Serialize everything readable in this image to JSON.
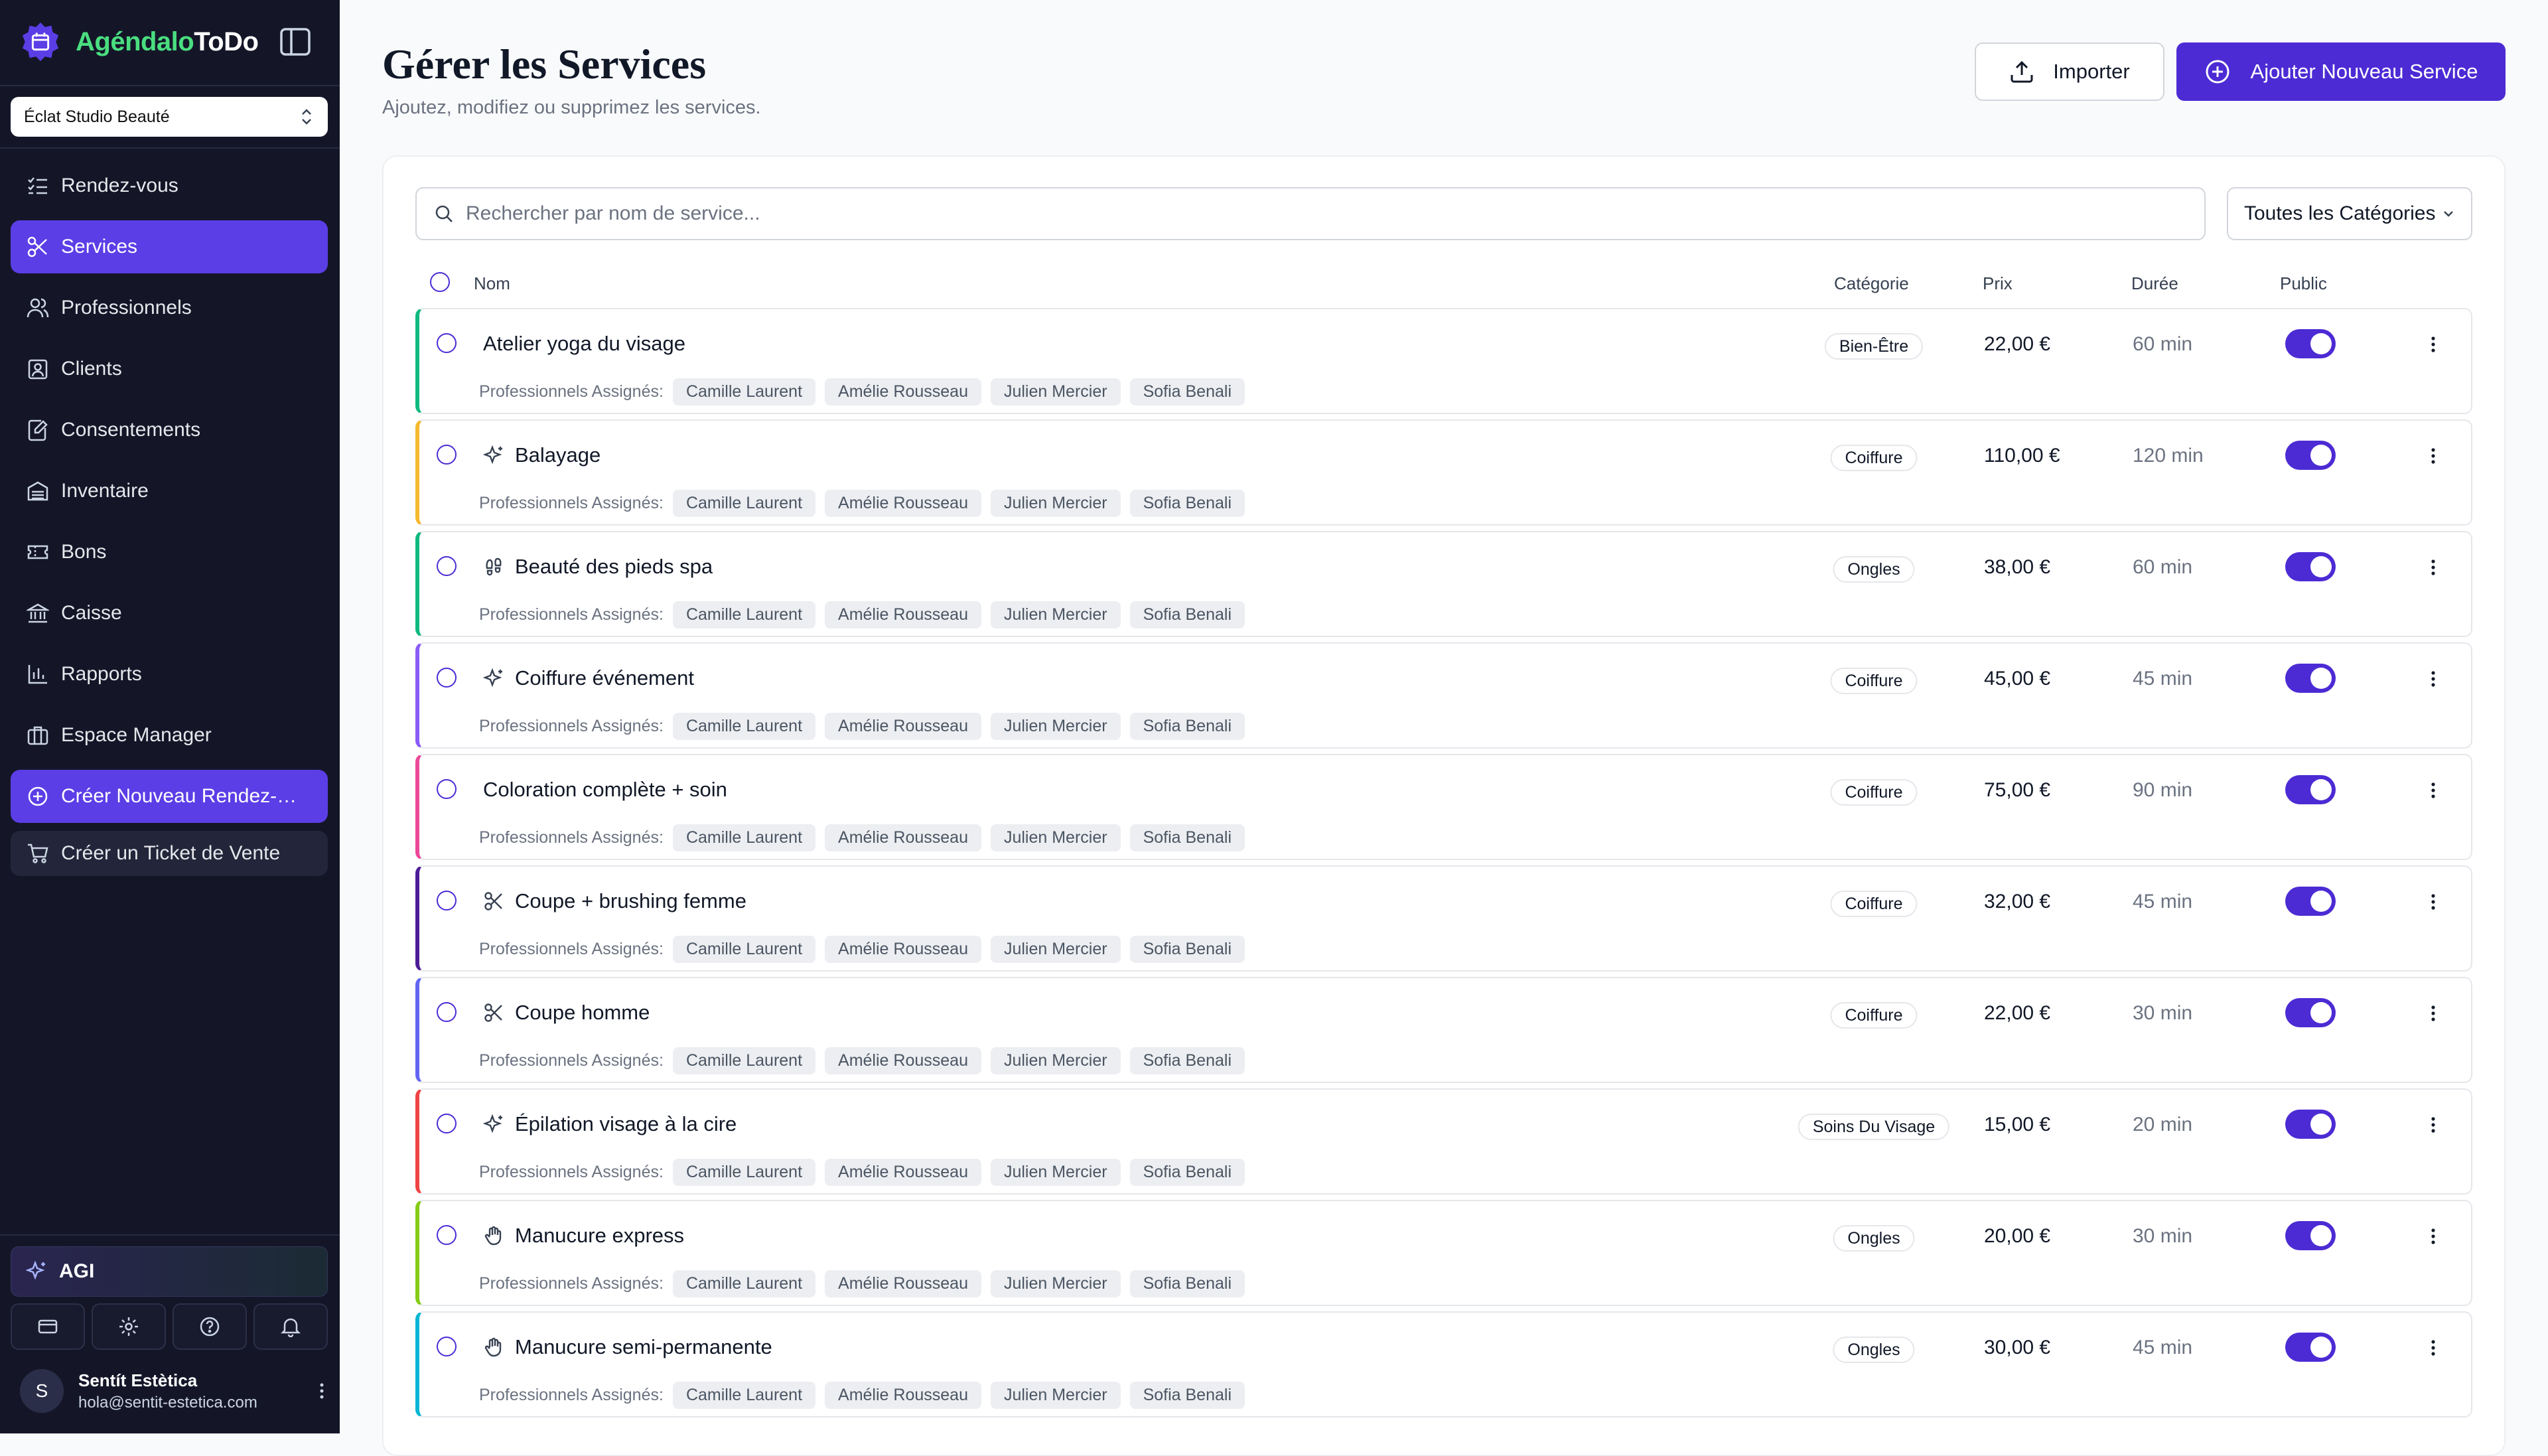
{
  "sidebar": {
    "brand_part1": "Agéndalo",
    "brand_part2": "ToDo",
    "org_selected": "Éclat Studio Beauté",
    "nav": [
      {
        "label": "Rendez-vous",
        "icon": "list-checks-icon"
      },
      {
        "label": "Services",
        "icon": "scissors-icon",
        "active": true
      },
      {
        "label": "Professionnels",
        "icon": "users-icon"
      },
      {
        "label": "Clients",
        "icon": "contact-icon"
      },
      {
        "label": "Consentements",
        "icon": "file-edit-icon"
      },
      {
        "label": "Inventaire",
        "icon": "inventory-icon"
      },
      {
        "label": "Bons",
        "icon": "ticket-icon"
      },
      {
        "label": "Caisse",
        "icon": "bank-icon"
      },
      {
        "label": "Rapports",
        "icon": "bar-chart-icon"
      },
      {
        "label": "Espace Manager",
        "icon": "briefcase-icon"
      }
    ],
    "cta_new_appointment": "Créer Nouveau Rendez-vous",
    "cta_sales_ticket": "Créer un Ticket de Vente",
    "agi_label": "AGI",
    "user": {
      "initial": "S",
      "name": "Sentít Estètica",
      "email": "hola@sentit-estetica.com"
    }
  },
  "header": {
    "title": "Gérer les Services",
    "subtitle": "Ajoutez, modifiez ou supprimez les services.",
    "import_label": "Importer",
    "add_label": "Ajouter Nouveau Service"
  },
  "toolbar": {
    "search_placeholder": "Rechercher par nom de service...",
    "category_filter": "Toutes les Catégories"
  },
  "table": {
    "columns": {
      "name": "Nom",
      "category": "Catégorie",
      "price": "Prix",
      "duration": "Durée",
      "public": "Public"
    },
    "assigned_label": "Professionnels Assignés:",
    "professionals": [
      "Camille Laurent",
      "Amélie Rousseau",
      "Julien Mercier",
      "Sofia Benali"
    ],
    "rows": [
      {
        "name": "Atelier yoga du visage",
        "icon": "",
        "category": "Bien-Être",
        "price": "22,00 €",
        "duration": "60 min",
        "public": true,
        "color": "#10b981"
      },
      {
        "name": "Balayage",
        "icon": "sparkles-icon",
        "category": "Coiffure",
        "price": "110,00 €",
        "duration": "120 min",
        "public": true,
        "color": "#f5b92e"
      },
      {
        "name": "Beauté des pieds spa",
        "icon": "footprints-icon",
        "category": "Ongles",
        "price": "38,00 €",
        "duration": "60 min",
        "public": true,
        "color": "#10b981"
      },
      {
        "name": "Coiffure événement",
        "icon": "sparkles-icon",
        "category": "Coiffure",
        "price": "45,00 €",
        "duration": "45 min",
        "public": true,
        "color": "#8b5cf6"
      },
      {
        "name": "Coloration complète + soin",
        "icon": "",
        "category": "Coiffure",
        "price": "75,00 €",
        "duration": "90 min",
        "public": true,
        "color": "#ec4899"
      },
      {
        "name": "Coupe + brushing femme",
        "icon": "scissors-icon",
        "category": "Coiffure",
        "price": "32,00 €",
        "duration": "45 min",
        "public": true,
        "color": "#4c1d95"
      },
      {
        "name": "Coupe homme",
        "icon": "scissors-icon",
        "category": "Coiffure",
        "price": "22,00 €",
        "duration": "30 min",
        "public": true,
        "color": "#6366f1"
      },
      {
        "name": "Épilation visage à la cire",
        "icon": "sparkles-icon",
        "category": "Soins Du Visage",
        "price": "15,00 €",
        "duration": "20 min",
        "public": true,
        "color": "#ef4444"
      },
      {
        "name": "Manucure express",
        "icon": "hand-icon",
        "category": "Ongles",
        "price": "20,00 €",
        "duration": "30 min",
        "public": true,
        "color": "#84cc16"
      },
      {
        "name": "Manucure semi-permanente",
        "icon": "hand-icon",
        "category": "Ongles",
        "price": "30,00 €",
        "duration": "45 min",
        "public": true,
        "color": "#06b6d4"
      }
    ]
  }
}
